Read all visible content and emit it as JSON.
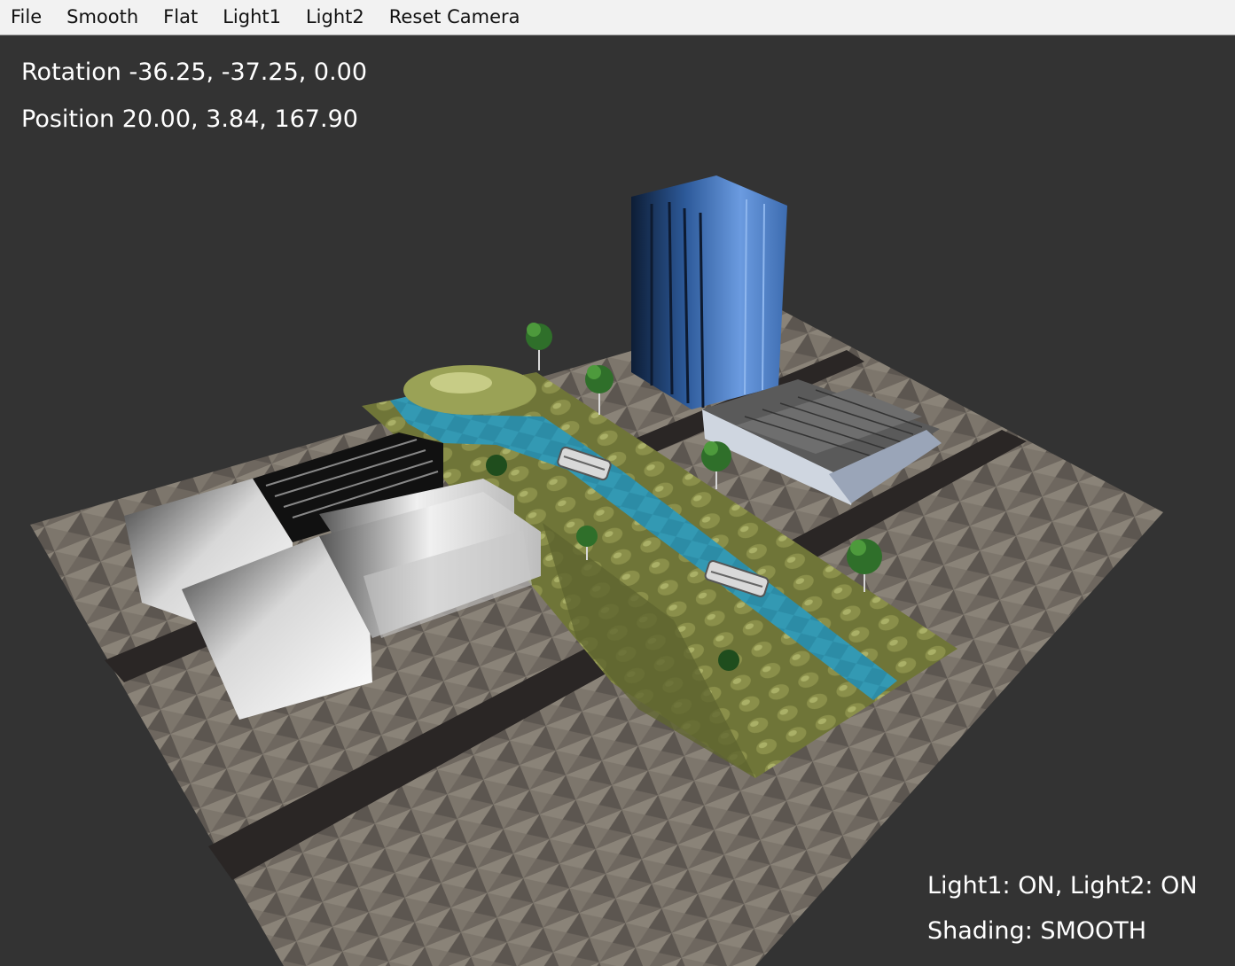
{
  "menu": {
    "file": "File",
    "smooth": "Smooth",
    "flat": "Flat",
    "light1": "Light1",
    "light2": "Light2",
    "reset_camera": "Reset Camera"
  },
  "hud": {
    "rotation": "Rotation -36.25, -37.25, 0.00",
    "position": "Position 20.00, 3.84, 167.90",
    "lights": "Light1: ON, Light2: ON",
    "shading": "Shading: SMOOTH"
  },
  "colors": {
    "background": "#333333",
    "ground": "#6e675f",
    "road": "#2a2625",
    "grass": "#6f7538",
    "water": "#2c8ca6",
    "tower": "#4a7cc6"
  }
}
